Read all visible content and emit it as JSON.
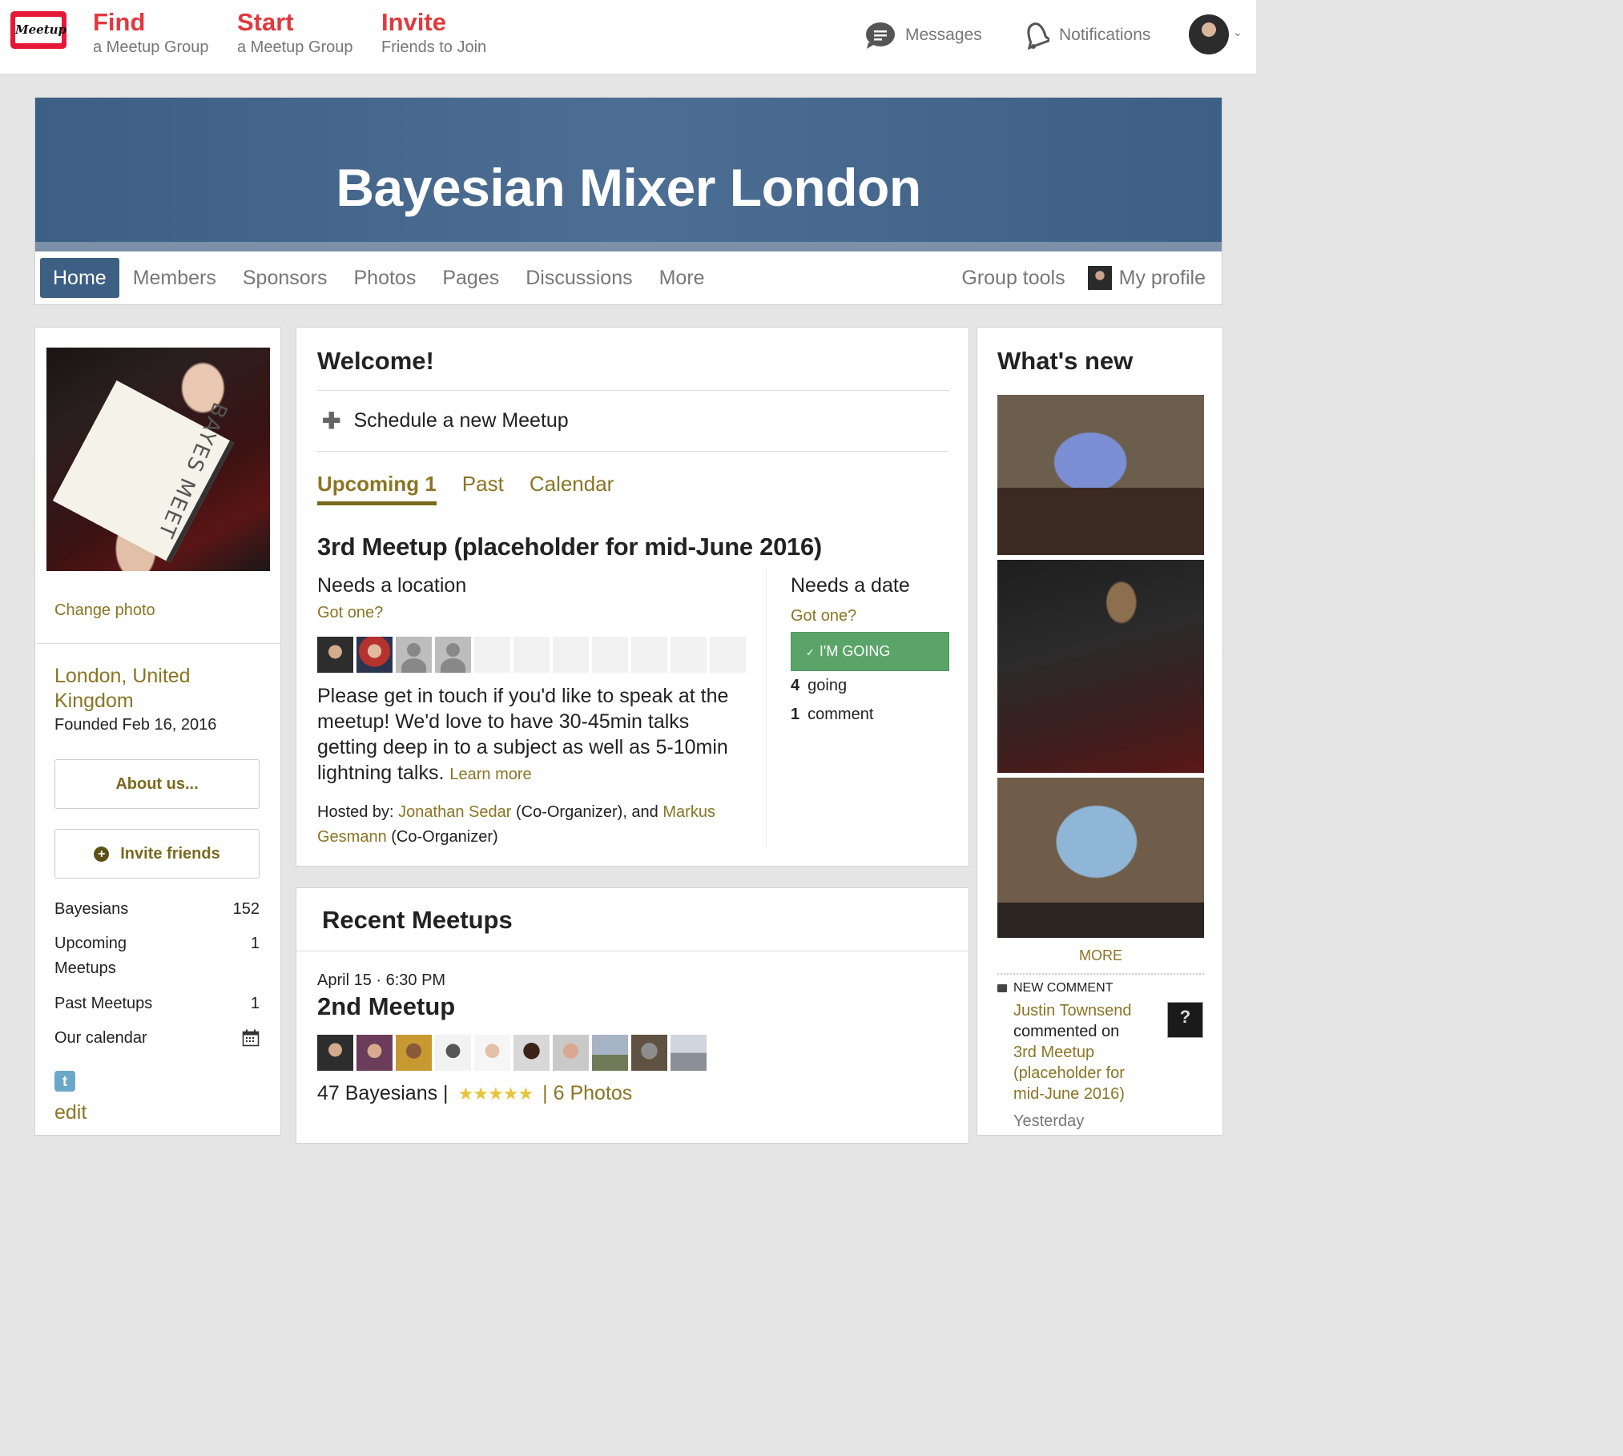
{
  "topnav": {
    "logo_text": "Meetup",
    "items": [
      {
        "big": "Find",
        "small": "a Meetup Group"
      },
      {
        "big": "Start",
        "small": "a Meetup Group"
      },
      {
        "big": "Invite",
        "small": "Friends to Join"
      }
    ],
    "messages": "Messages",
    "notifications": "Notifications",
    "caret": "⌄"
  },
  "group": {
    "title": "Bayesian Mixer London",
    "tabs": [
      "Home",
      "Members",
      "Sponsors",
      "Photos",
      "Pages",
      "Discussions",
      "More"
    ],
    "group_tools": "Group tools",
    "my_profile": "My profile"
  },
  "left": {
    "change_photo": "Change photo",
    "location": "London, United Kingdom",
    "founded": "Founded Feb 16, 2016",
    "about_button": "About us...",
    "invite_button": "Invite friends",
    "stats": [
      {
        "label": "Bayesians",
        "value": "152"
      },
      {
        "label": "Upcoming Meetups",
        "value": "1"
      },
      {
        "label": "Past Meetups",
        "value": "1"
      },
      {
        "label": "Our calendar",
        "value": ""
      }
    ],
    "twitter_glyph": "t",
    "edit": "edit"
  },
  "welcome": {
    "title": "Welcome!",
    "schedule": "Schedule a new Meetup",
    "subtabs": [
      "Upcoming 1",
      "Past",
      "Calendar"
    ],
    "event": {
      "title": "3rd Meetup (placeholder for mid-June 2016)",
      "needs_location": "Needs a location",
      "got_one_location": "Got one?",
      "description": "Please get in touch if you'd like to speak at the meetup! We'd love to have 30-45min talks getting deep in to a subject as well as 5-10min lightning talks.",
      "learn_more": "Learn more",
      "hosted_prefix": "Hosted by: ",
      "host1": "Jonathan Sedar",
      "host1_role": " (Co-Organizer), and ",
      "host2": "Markus Gesmann",
      "host2_role": " (Co-Organizer)",
      "needs_date": "Needs a date",
      "got_one_date": "Got one?",
      "going_button": "I'M GOING",
      "going_count": "4",
      "going_label": "going",
      "comment_count": "1",
      "comment_label": "comment"
    }
  },
  "recent": {
    "title": "Recent Meetups",
    "date": "April 15 · 6:30 PM",
    "name": "2nd Meetup",
    "attendees_text": "47 Bayesians |",
    "stars": "★★★★★",
    "photos": "| 6 Photos"
  },
  "whatsnew": {
    "title": "What's new",
    "more": "MORE",
    "label": "NEW COMMENT",
    "commenter": "Justin Townsend",
    "commented_on": "commented on",
    "target": "3rd Meetup (placeholder for mid-June 2016)",
    "when": "Yesterday",
    "thumb_glyph": "?"
  }
}
